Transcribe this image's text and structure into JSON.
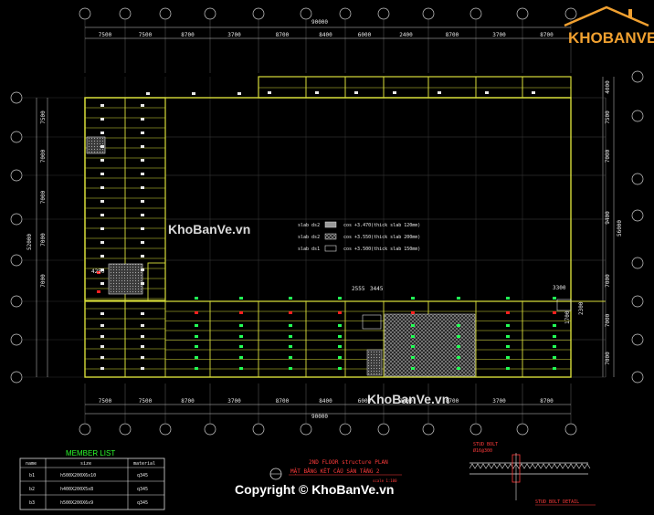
{
  "brand": {
    "logo_text": "KHOBANVE",
    "watermark": "KhoBanVe.vn",
    "copyright": "Copyright © KhoBanVe.vn"
  },
  "colors": {
    "background": "#000000",
    "beam": "#d7dd3a",
    "grid": "#bdbdbd",
    "red_label": "#ff2020",
    "green_label": "#22ff55",
    "text": "#e8e8e8"
  },
  "plan": {
    "top_total": "90000",
    "bottom_total": "90000",
    "left_total": "52000",
    "right_total": "56000",
    "column_spans": [
      "7500",
      "7500",
      "8700",
      "3700",
      "8700",
      "8400",
      "6000",
      "2400",
      "8700",
      "3700",
      "8700"
    ],
    "left_spans": [
      "7500",
      "7000",
      "7000",
      "7000",
      "7000"
    ],
    "right_spans": [
      "4000",
      "7500",
      "7000",
      "9400",
      "7000",
      "7000",
      "7000"
    ],
    "notes": [
      "4250",
      "2555",
      "3445",
      "3300",
      "1700",
      "2300"
    ]
  },
  "slab_legend": [
    {
      "label": "slab ds2",
      "text": "cos +3.470(thick slab 120mm)"
    },
    {
      "label": "slab ds2",
      "text": "cos +3.550(thick slab 200mm)"
    },
    {
      "label": "slab ds1",
      "text": "cos +3.500(thick slab 150mm)"
    }
  ],
  "title_block": {
    "line1": "2ND FLOOR structure PLAN",
    "line2": "MẶT BẰNG KẾT CẤU SÀN TẦNG 2",
    "scale": "scale 1:100"
  },
  "member_list": {
    "title": "MEMBER LIST",
    "headers": [
      "name",
      "size",
      "material"
    ],
    "rows": [
      [
        "b1",
        "h500X200X6x10",
        "q345"
      ],
      [
        "b2",
        "h400X200X5x8",
        "q345"
      ],
      [
        "b3",
        "h500X200X6x9",
        "q345"
      ]
    ]
  },
  "stud_detail": {
    "title": "STUD BOLT DETAIL",
    "label": "STUD BOLT",
    "spec": "Ø16@300"
  }
}
